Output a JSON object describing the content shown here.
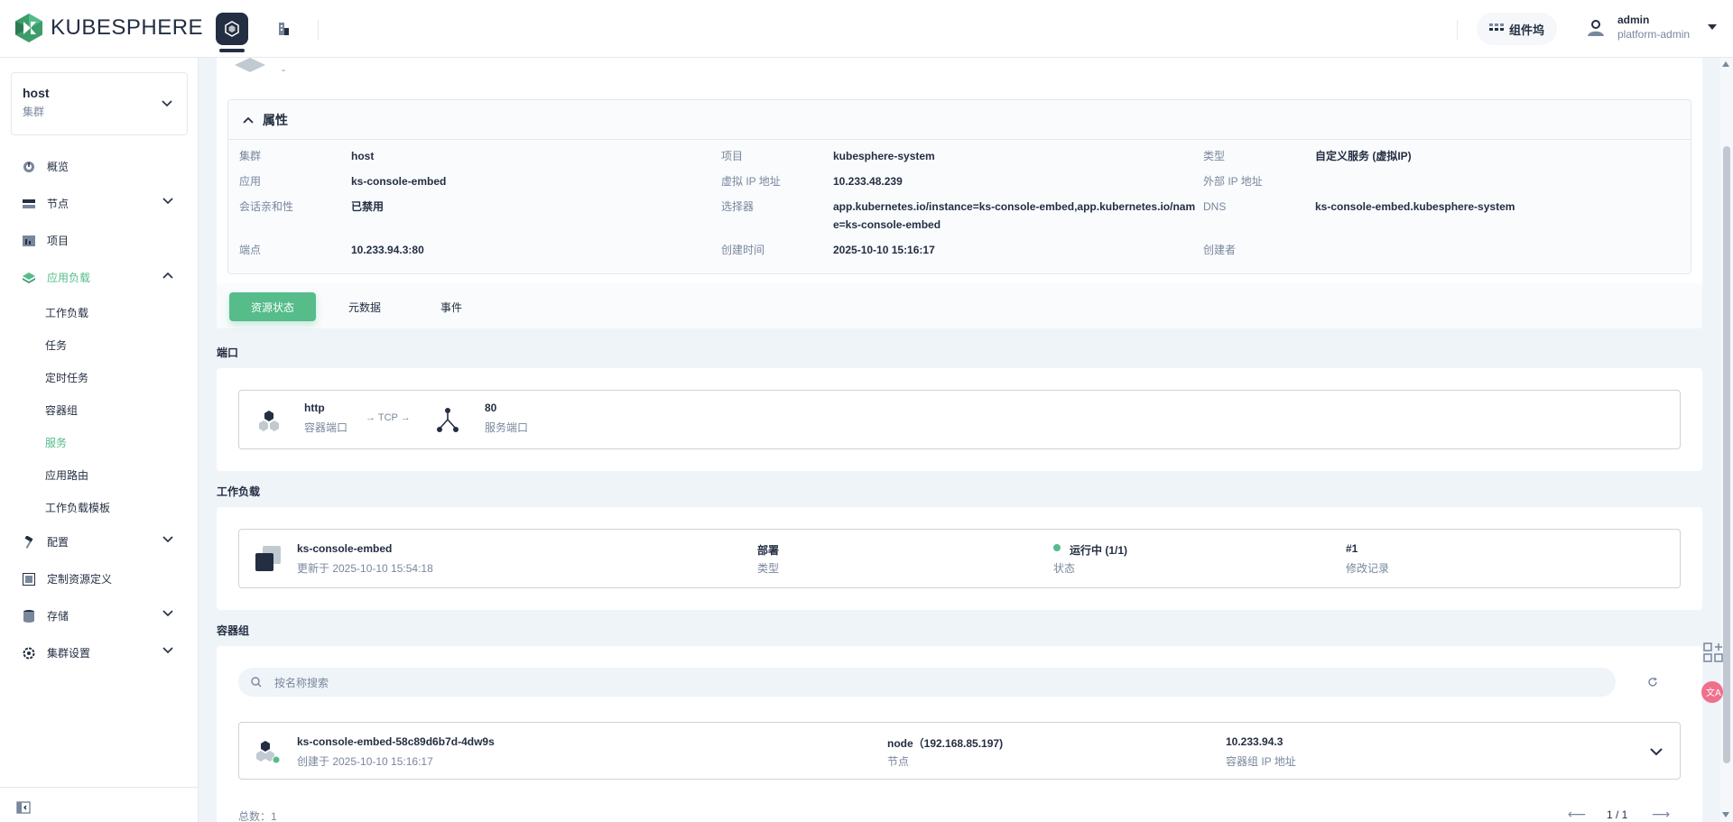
{
  "app": {
    "logo_text": "KUBESPHERE"
  },
  "topbar": {
    "extensions_label": "组件坞",
    "user_name": "admin",
    "user_role": "platform-admin"
  },
  "sidebar": {
    "cluster_name": "host",
    "cluster_type": "集群",
    "menu": [
      {
        "label": "概览",
        "icon": "dashboard-icon"
      },
      {
        "label": "节点",
        "icon": "nodes-icon"
      },
      {
        "label": "项目",
        "icon": "project-icon"
      },
      {
        "label": "应用负载",
        "icon": "appcenter-icon"
      },
      {
        "label": "配置",
        "icon": "hammer-icon"
      },
      {
        "label": "定制资源定义",
        "icon": "crd-icon"
      },
      {
        "label": "存储",
        "icon": "database-icon"
      },
      {
        "label": "集群设置",
        "icon": "gear-icon"
      }
    ],
    "submenu": [
      "工作负载",
      "任务",
      "定时任务",
      "容器组",
      "服务",
      "应用路由",
      "工作负载模板"
    ]
  },
  "detail": {
    "top_dash": "-",
    "attrs_title": "属性",
    "attrs": {
      "cluster_key": "集群",
      "cluster_val": "host",
      "project_key": "项目",
      "project_val": "kubesphere-system",
      "type_key": "类型",
      "type_val": "自定义服务 (虚拟IP)",
      "app_key": "应用",
      "app_val": "ks-console-embed",
      "vip_key": "虚拟 IP 地址",
      "vip_val": "10.233.48.239",
      "extip_key": "外部 IP 地址",
      "affinity_key": "会话亲和性",
      "affinity_val": "已禁用",
      "selector_key": "选择器",
      "selector_val_1": "app.kubernetes.io/instance=ks-console-embed,app.kubernetes.io/nam",
      "selector_val_2": "e=ks-console-embed",
      "dns_key": "DNS",
      "dns_val": "ks-console-embed.kubesphere-system",
      "endpoint_key": "端点",
      "endpoint_val": "10.233.94.3:80",
      "created_key": "创建时间",
      "created_val": "2025-10-10 15:16:17",
      "creator_key": "创建者"
    },
    "tabs": [
      "资源状态",
      "元数据",
      "事件"
    ]
  },
  "ports": {
    "title": "端口",
    "container_port_name": "http",
    "container_port_label": "容器端口",
    "protocol": "→ TCP →",
    "service_port": "80",
    "service_port_label": "服务端口"
  },
  "workloads": {
    "title": "工作负载",
    "name": "ks-console-embed",
    "updated": "更新于 2025-10-10 15:54:18",
    "kind": "部署",
    "kind_label": "类型",
    "status": "运行中 (1/1)",
    "status_label": "状态",
    "revision": "#1",
    "revision_label": "修改记录"
  },
  "pods": {
    "title": "容器组",
    "search_placeholder": "按名称搜索",
    "pod_name": "ks-console-embed-58c89d6b7d-4dw9s",
    "pod_created": "创建于 2025-10-10 15:16:17",
    "node": "node（192.168.85.197)",
    "node_label": "节点",
    "pod_ip": "10.233.94.3",
    "pod_ip_label": "容器组 IP 地址",
    "total": "总数：1",
    "page": "1 / 1"
  },
  "colors": {
    "accent": "#55bc8a",
    "dark": "#242e42",
    "muted": "#79879c",
    "border": "#e3e9ef"
  }
}
